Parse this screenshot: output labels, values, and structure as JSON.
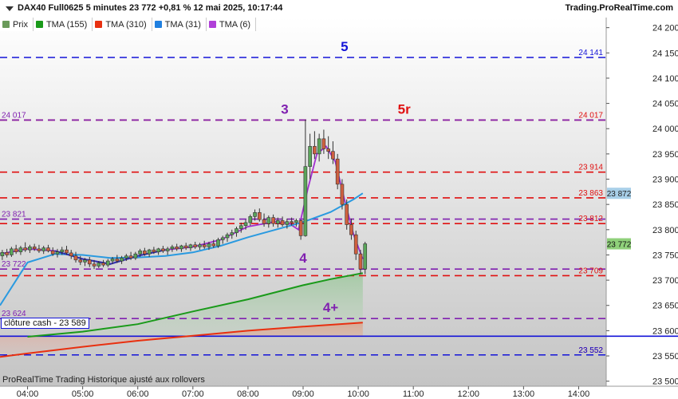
{
  "header": {
    "title": "DAX40 Full0625 5 minutes 23 772 +0,81 % 12 mai 2025, 10:17:44",
    "brand": "Trading.ProRealTime.com"
  },
  "legend": [
    {
      "label": "Prix",
      "color": "#6a9a5a"
    },
    {
      "label": "TMA (155)",
      "color": "#1a9a1a"
    },
    {
      "label": "TMA (310)",
      "color": "#e83010"
    },
    {
      "label": "TMA (31)",
      "color": "#2080e0"
    },
    {
      "label": "TMA (6)",
      "color": "#b040d8"
    }
  ],
  "footnote": "ProRealTime Trading  Historique ajusté aux rollovers",
  "cash_label": "clôture cash -  23 589",
  "chart_data": {
    "type": "candlestick",
    "ylim": [
      23490,
      24220
    ],
    "xlim": [
      "03:30",
      "14:30"
    ],
    "y_ticks": [
      "24 200",
      "24 150",
      "24 100",
      "24 050",
      "24 000",
      "23 950",
      "23 900",
      "23 850",
      "23 800",
      "23 750",
      "23 700",
      "23 650",
      "23 600",
      "23 550",
      "23 500"
    ],
    "y_tick_values": [
      24200,
      24150,
      24100,
      24050,
      24000,
      23950,
      23900,
      23850,
      23800,
      23750,
      23700,
      23650,
      23600,
      23550,
      23500
    ],
    "x_ticks": [
      "04:00",
      "05:00",
      "06:00",
      "07:00",
      "08:00",
      "09:00",
      "10:00",
      "11:00",
      "12:00",
      "13:00",
      "14:00"
    ],
    "x_tick_values": [
      "04:00",
      "05:00",
      "06:00",
      "07:00",
      "08:00",
      "09:00",
      "10:00",
      "11:00",
      "12:00",
      "13:00",
      "14:00"
    ],
    "levels": [
      {
        "value": 24141,
        "color": "#1414d8",
        "right_label": "24 141",
        "left_label": "",
        "note": "5",
        "note_at": "09:45"
      },
      {
        "value": 24017,
        "color": "#e01010",
        "right_label": "24 017",
        "left_label": "",
        "note": "5r",
        "note_at": "10:50"
      },
      {
        "value": 24017,
        "color": "#8020b0",
        "right_label": "",
        "left_label": "24 017",
        "note": "3",
        "note_at": "08:40"
      },
      {
        "value": 23914,
        "color": "#e01010",
        "right_label": "23 914",
        "left_label": "",
        "note": "",
        "note_at": ""
      },
      {
        "value": 23863,
        "color": "#e01010",
        "right_label": "23 863",
        "left_label": "",
        "note": "",
        "note_at": ""
      },
      {
        "value": 23821,
        "color": "#8020b0",
        "right_label": "",
        "left_label": "23 821",
        "note": "",
        "note_at": ""
      },
      {
        "value": 23812,
        "color": "#e01010",
        "right_label": "23 812",
        "left_label": "",
        "note": "",
        "note_at": ""
      },
      {
        "value": 23722,
        "color": "#8020b0",
        "right_label": "",
        "left_label": "23 722",
        "note": "4",
        "note_at": "09:00"
      },
      {
        "value": 23709,
        "color": "#e01010",
        "right_label": "23 709",
        "left_label": "",
        "note": "",
        "note_at": ""
      },
      {
        "value": 23624,
        "color": "#8020b0",
        "right_label": "",
        "left_label": "23 624",
        "note": "4+",
        "note_at": "09:30"
      },
      {
        "value": 23552,
        "color": "#e01010",
        "right_label": "23 552",
        "left_label": "",
        "note": "",
        "note_at": ""
      },
      {
        "value": 23552,
        "color": "#1414d8",
        "right_label": "23 552",
        "left_label": "",
        "note": "",
        "note_at": ""
      }
    ],
    "cash_close": 23589,
    "current_price": {
      "value": 23772,
      "label": "23 772"
    },
    "tma31_last": {
      "value": 23872,
      "label": "23 872"
    },
    "candles": [
      {
        "t": "03:30",
        "o": 23748,
        "h": 23760,
        "l": 23740,
        "c": 23755
      },
      {
        "t": "03:35",
        "o": 23755,
        "h": 23762,
        "l": 23745,
        "c": 23750
      },
      {
        "t": "03:40",
        "o": 23750,
        "h": 23766,
        "l": 23746,
        "c": 23762
      },
      {
        "t": "03:45",
        "o": 23762,
        "h": 23770,
        "l": 23752,
        "c": 23756
      },
      {
        "t": "03:50",
        "o": 23756,
        "h": 23768,
        "l": 23750,
        "c": 23764
      },
      {
        "t": "03:55",
        "o": 23764,
        "h": 23775,
        "l": 23756,
        "c": 23760
      },
      {
        "t": "04:00",
        "o": 23760,
        "h": 23770,
        "l": 23754,
        "c": 23766
      },
      {
        "t": "04:05",
        "o": 23766,
        "h": 23772,
        "l": 23758,
        "c": 23762
      },
      {
        "t": "04:10",
        "o": 23762,
        "h": 23770,
        "l": 23754,
        "c": 23758
      },
      {
        "t": "04:15",
        "o": 23758,
        "h": 23768,
        "l": 23752,
        "c": 23764
      },
      {
        "t": "04:20",
        "o": 23764,
        "h": 23770,
        "l": 23755,
        "c": 23758
      },
      {
        "t": "04:25",
        "o": 23758,
        "h": 23765,
        "l": 23748,
        "c": 23752
      },
      {
        "t": "04:30",
        "o": 23752,
        "h": 23762,
        "l": 23745,
        "c": 23756
      },
      {
        "t": "04:35",
        "o": 23756,
        "h": 23766,
        "l": 23750,
        "c": 23760
      },
      {
        "t": "04:40",
        "o": 23760,
        "h": 23768,
        "l": 23750,
        "c": 23754
      },
      {
        "t": "04:45",
        "o": 23754,
        "h": 23760,
        "l": 23742,
        "c": 23748
      },
      {
        "t": "04:50",
        "o": 23748,
        "h": 23756,
        "l": 23735,
        "c": 23740
      },
      {
        "t": "04:55",
        "o": 23740,
        "h": 23748,
        "l": 23730,
        "c": 23736
      },
      {
        "t": "05:00",
        "o": 23736,
        "h": 23744,
        "l": 23728,
        "c": 23740
      },
      {
        "t": "05:05",
        "o": 23740,
        "h": 23746,
        "l": 23726,
        "c": 23732
      },
      {
        "t": "05:10",
        "o": 23732,
        "h": 23740,
        "l": 23722,
        "c": 23728
      },
      {
        "t": "05:15",
        "o": 23728,
        "h": 23738,
        "l": 23724,
        "c": 23734
      },
      {
        "t": "05:20",
        "o": 23734,
        "h": 23740,
        "l": 23726,
        "c": 23730
      },
      {
        "t": "05:25",
        "o": 23730,
        "h": 23742,
        "l": 23726,
        "c": 23738
      },
      {
        "t": "05:30",
        "o": 23738,
        "h": 23746,
        "l": 23732,
        "c": 23742
      },
      {
        "t": "05:35",
        "o": 23742,
        "h": 23750,
        "l": 23734,
        "c": 23738
      },
      {
        "t": "05:40",
        "o": 23738,
        "h": 23748,
        "l": 23732,
        "c": 23744
      },
      {
        "t": "05:45",
        "o": 23744,
        "h": 23752,
        "l": 23738,
        "c": 23748
      },
      {
        "t": "05:50",
        "o": 23748,
        "h": 23756,
        "l": 23740,
        "c": 23744
      },
      {
        "t": "05:55",
        "o": 23744,
        "h": 23756,
        "l": 23740,
        "c": 23752
      },
      {
        "t": "06:00",
        "o": 23752,
        "h": 23762,
        "l": 23746,
        "c": 23758
      },
      {
        "t": "06:05",
        "o": 23758,
        "h": 23764,
        "l": 23748,
        "c": 23752
      },
      {
        "t": "06:10",
        "o": 23752,
        "h": 23762,
        "l": 23746,
        "c": 23760
      },
      {
        "t": "06:15",
        "o": 23760,
        "h": 23766,
        "l": 23752,
        "c": 23756
      },
      {
        "t": "06:20",
        "o": 23756,
        "h": 23764,
        "l": 23750,
        "c": 23762
      },
      {
        "t": "06:25",
        "o": 23762,
        "h": 23768,
        "l": 23754,
        "c": 23758
      },
      {
        "t": "06:30",
        "o": 23758,
        "h": 23766,
        "l": 23750,
        "c": 23762
      },
      {
        "t": "06:35",
        "o": 23762,
        "h": 23770,
        "l": 23756,
        "c": 23766
      },
      {
        "t": "06:40",
        "o": 23766,
        "h": 23772,
        "l": 23758,
        "c": 23762
      },
      {
        "t": "06:45",
        "o": 23762,
        "h": 23770,
        "l": 23756,
        "c": 23768
      },
      {
        "t": "06:50",
        "o": 23768,
        "h": 23774,
        "l": 23760,
        "c": 23764
      },
      {
        "t": "06:55",
        "o": 23764,
        "h": 23772,
        "l": 23758,
        "c": 23770
      },
      {
        "t": "07:00",
        "o": 23770,
        "h": 23776,
        "l": 23762,
        "c": 23766
      },
      {
        "t": "07:05",
        "o": 23766,
        "h": 23774,
        "l": 23760,
        "c": 23770
      },
      {
        "t": "07:10",
        "o": 23770,
        "h": 23778,
        "l": 23762,
        "c": 23766
      },
      {
        "t": "07:15",
        "o": 23766,
        "h": 23776,
        "l": 23760,
        "c": 23772
      },
      {
        "t": "07:20",
        "o": 23772,
        "h": 23780,
        "l": 23764,
        "c": 23768
      },
      {
        "t": "07:25",
        "o": 23768,
        "h": 23784,
        "l": 23764,
        "c": 23780
      },
      {
        "t": "07:30",
        "o": 23780,
        "h": 23788,
        "l": 23772,
        "c": 23784
      },
      {
        "t": "07:35",
        "o": 23784,
        "h": 23794,
        "l": 23776,
        "c": 23790
      },
      {
        "t": "07:40",
        "o": 23790,
        "h": 23800,
        "l": 23782,
        "c": 23794
      },
      {
        "t": "07:45",
        "o": 23794,
        "h": 23806,
        "l": 23786,
        "c": 23802
      },
      {
        "t": "07:50",
        "o": 23802,
        "h": 23814,
        "l": 23794,
        "c": 23808
      },
      {
        "t": "07:55",
        "o": 23808,
        "h": 23820,
        "l": 23800,
        "c": 23814
      },
      {
        "t": "08:00",
        "o": 23814,
        "h": 23830,
        "l": 23808,
        "c": 23826
      },
      {
        "t": "08:05",
        "o": 23826,
        "h": 23840,
        "l": 23818,
        "c": 23834
      },
      {
        "t": "08:10",
        "o": 23834,
        "h": 23842,
        "l": 23816,
        "c": 23820
      },
      {
        "t": "08:15",
        "o": 23820,
        "h": 23832,
        "l": 23806,
        "c": 23812
      },
      {
        "t": "08:20",
        "o": 23812,
        "h": 23828,
        "l": 23804,
        "c": 23824
      },
      {
        "t": "08:25",
        "o": 23824,
        "h": 23830,
        "l": 23806,
        "c": 23812
      },
      {
        "t": "08:30",
        "o": 23812,
        "h": 23824,
        "l": 23804,
        "c": 23818
      },
      {
        "t": "08:35",
        "o": 23818,
        "h": 23826,
        "l": 23806,
        "c": 23810
      },
      {
        "t": "08:40",
        "o": 23810,
        "h": 23822,
        "l": 23802,
        "c": 23816
      },
      {
        "t": "08:45",
        "o": 23816,
        "h": 23824,
        "l": 23808,
        "c": 23814
      },
      {
        "t": "08:50",
        "o": 23814,
        "h": 23822,
        "l": 23806,
        "c": 23818
      },
      {
        "t": "08:55",
        "o": 23818,
        "h": 23820,
        "l": 23780,
        "c": 23788
      },
      {
        "t": "09:00",
        "o": 23788,
        "h": 24018,
        "l": 23786,
        "c": 23925
      },
      {
        "t": "09:05",
        "o": 23925,
        "h": 23990,
        "l": 23900,
        "c": 23965
      },
      {
        "t": "09:10",
        "o": 23965,
        "h": 23995,
        "l": 23940,
        "c": 23950
      },
      {
        "t": "09:15",
        "o": 23950,
        "h": 23990,
        "l": 23935,
        "c": 23980
      },
      {
        "t": "09:20",
        "o": 23980,
        "h": 23998,
        "l": 23950,
        "c": 23960
      },
      {
        "t": "09:25",
        "o": 23960,
        "h": 23985,
        "l": 23940,
        "c": 23955
      },
      {
        "t": "09:30",
        "o": 23955,
        "h": 23975,
        "l": 23930,
        "c": 23940
      },
      {
        "t": "09:35",
        "o": 23940,
        "h": 23950,
        "l": 23880,
        "c": 23890
      },
      {
        "t": "09:40",
        "o": 23890,
        "h": 23900,
        "l": 23840,
        "c": 23850
      },
      {
        "t": "09:45",
        "o": 23850,
        "h": 23860,
        "l": 23800,
        "c": 23810
      },
      {
        "t": "09:50",
        "o": 23810,
        "h": 23822,
        "l": 23780,
        "c": 23790
      },
      {
        "t": "09:55",
        "o": 23790,
        "h": 23798,
        "l": 23740,
        "c": 23752
      },
      {
        "t": "10:00",
        "o": 23752,
        "h": 23760,
        "l": 23712,
        "c": 23722
      },
      {
        "t": "10:05",
        "o": 23722,
        "h": 23776,
        "l": 23712,
        "c": 23772
      }
    ],
    "series": [
      {
        "name": "TMA (6)",
        "color": "#a030d0",
        "points": [
          [
            "03:30",
            23752
          ],
          [
            "04:00",
            23762
          ],
          [
            "04:30",
            23758
          ],
          [
            "05:00",
            23742
          ],
          [
            "05:30",
            23732
          ],
          [
            "06:00",
            23748
          ],
          [
            "06:30",
            23760
          ],
          [
            "07:00",
            23766
          ],
          [
            "07:30",
            23780
          ],
          [
            "08:00",
            23806
          ],
          [
            "08:30",
            23816
          ],
          [
            "08:45",
            23812
          ],
          [
            "08:55",
            23800
          ],
          [
            "09:05",
            23880
          ],
          [
            "09:15",
            23950
          ],
          [
            "09:25",
            23965
          ],
          [
            "09:35",
            23935
          ],
          [
            "09:45",
            23860
          ],
          [
            "09:55",
            23790
          ],
          [
            "10:05",
            23742
          ]
        ]
      },
      {
        "name": "TMA (31)",
        "color": "#2a9ae0",
        "points": [
          [
            "03:30",
            23650
          ],
          [
            "04:00",
            23735
          ],
          [
            "04:30",
            23752
          ],
          [
            "05:00",
            23750
          ],
          [
            "05:30",
            23744
          ],
          [
            "06:00",
            23745
          ],
          [
            "06:30",
            23748
          ],
          [
            "07:00",
            23755
          ],
          [
            "07:30",
            23768
          ],
          [
            "08:00",
            23785
          ],
          [
            "08:30",
            23800
          ],
          [
            "09:00",
            23815
          ],
          [
            "09:30",
            23835
          ],
          [
            "09:55",
            23860
          ],
          [
            "10:05",
            23872
          ]
        ]
      },
      {
        "name": "TMA (155)",
        "color": "#1a9a1a",
        "fill": "#1a9a1a",
        "points": [
          [
            "04:00",
            23588
          ],
          [
            "05:00",
            23598
          ],
          [
            "06:00",
            23613
          ],
          [
            "07:00",
            23638
          ],
          [
            "08:00",
            23662
          ],
          [
            "09:00",
            23690
          ],
          [
            "09:30",
            23702
          ],
          [
            "10:05",
            23714
          ]
        ]
      },
      {
        "name": "TMA (310)",
        "color": "#e83010",
        "fill": "#e05030",
        "points": [
          [
            "03:30",
            23548
          ],
          [
            "04:00",
            23555
          ],
          [
            "05:00",
            23568
          ],
          [
            "06:00",
            23580
          ],
          [
            "07:00",
            23590
          ],
          [
            "08:00",
            23600
          ],
          [
            "09:00",
            23608
          ],
          [
            "10:05",
            23616
          ]
        ]
      }
    ]
  }
}
